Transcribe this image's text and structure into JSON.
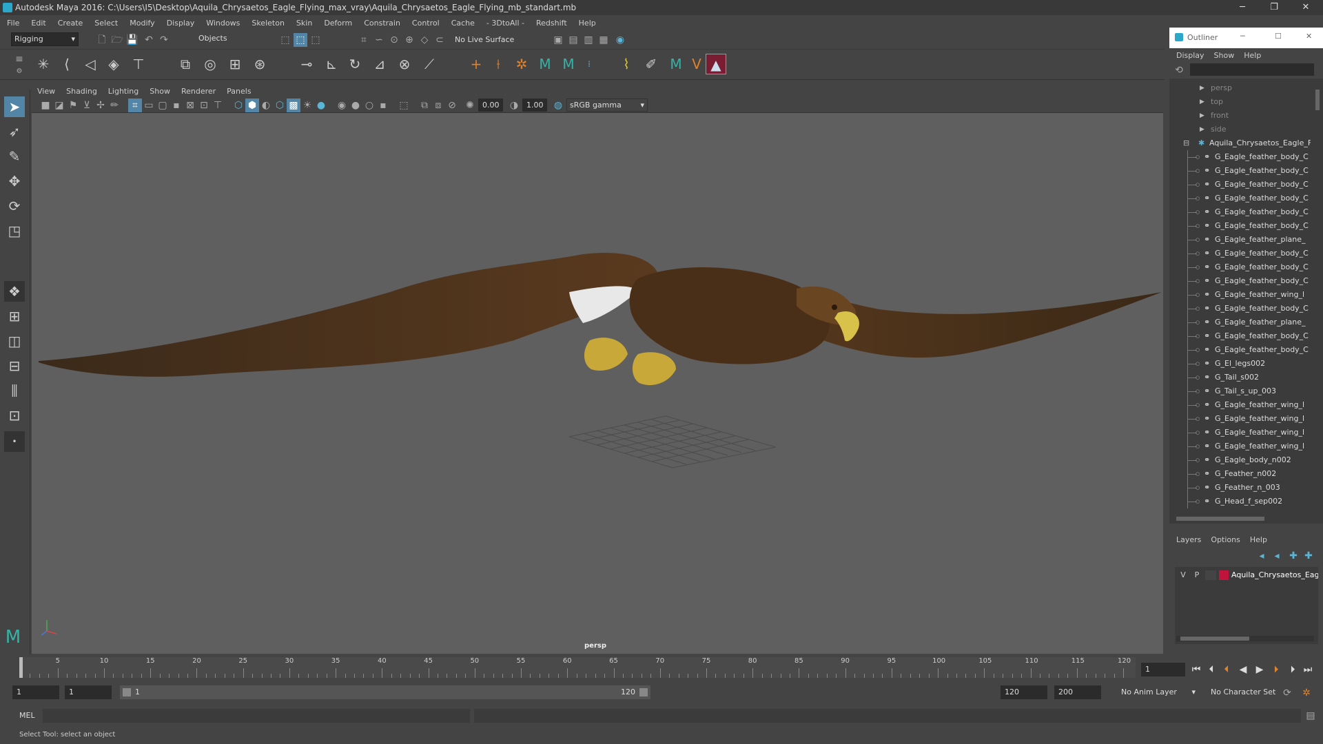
{
  "window": {
    "title": "Autodesk Maya 2016: C:\\Users\\I5\\Desktop\\Aquila_Chrysaetos_Eagle_Flying_max_vray\\Aquila_Chrysaetos_Eagle_Flying_mb_standart.mb",
    "minimize": "─",
    "maximize": "❐",
    "close": "✕"
  },
  "menubar": [
    "File",
    "Edit",
    "Create",
    "Select",
    "Modify",
    "Display",
    "Windows",
    "Skeleton",
    "Skin",
    "Deform",
    "Constrain",
    "Control",
    "Cache",
    "- 3DtoAll -",
    "Redshift",
    "Help"
  ],
  "statusline": {
    "mode": "Rigging",
    "selection_mask": "Objects",
    "live_surface": "No Live Surface"
  },
  "viewport": {
    "menu": [
      "View",
      "Shading",
      "Lighting",
      "Show",
      "Renderer",
      "Panels"
    ],
    "exposure": "0.00",
    "gamma": "1.00",
    "color_space": "sRGB gamma",
    "camera_label": "persp"
  },
  "outliner": {
    "title": "Outliner",
    "menu": [
      "Display",
      "Show",
      "Help"
    ],
    "cameras": [
      "persp",
      "top",
      "front",
      "side"
    ],
    "root": "Aquila_Chrysaetos_Eagle_Fly",
    "items": [
      "G_Eagle_feather_body_C",
      "G_Eagle_feather_body_C",
      "G_Eagle_feather_body_C",
      "G_Eagle_feather_body_C",
      "G_Eagle_feather_body_C",
      "G_Eagle_feather_body_C",
      "G_Eagle_feather_plane_",
      "G_Eagle_feather_body_C",
      "G_Eagle_feather_body_C",
      "G_Eagle_feather_body_C",
      "G_Eagle_feather_wing_l",
      "G_Eagle_feather_body_C",
      "G_Eagle_feather_plane_",
      "G_Eagle_feather_body_C",
      "G_Eagle_feather_body_C",
      "G_El_legs002",
      "G_Tail_s002",
      "G_Tail_s_up_003",
      "G_Eagle_feather_wing_l",
      "G_Eagle_feather_wing_l",
      "G_Eagle_feather_wing_l",
      "G_Eagle_feather_wing_l",
      "G_Eagle_body_n002",
      "G_Feather_n002",
      "G_Feather_n_003",
      "G_Head_f_sep002"
    ]
  },
  "layers": {
    "menu": [
      "Layers",
      "Options",
      "Help"
    ],
    "row": {
      "v": "V",
      "p": "P",
      "name": "Aquila_Chrysaetos_Eag",
      "color": "#c0143c"
    }
  },
  "timeline": {
    "ticks": [
      "1",
      "5",
      "10",
      "15",
      "20",
      "25",
      "30",
      "35",
      "40",
      "45",
      "50",
      "55",
      "60",
      "65",
      "70",
      "75",
      "80",
      "85",
      "90",
      "95",
      "100",
      "105",
      "110",
      "115",
      "120"
    ],
    "current_frame": "1"
  },
  "range": {
    "start": "1",
    "playback_start": "1",
    "slider_start": "1",
    "slider_end": "120",
    "playback_end": "120",
    "end": "200",
    "anim_layer": "No Anim Layer",
    "character_set": "No Character Set"
  },
  "cmdline": {
    "label": "MEL"
  },
  "helpline": {
    "text": "Select Tool: select an object"
  },
  "colors": {
    "accent": "#5285a6",
    "viewport_bg": "#5f5f5f",
    "layer_color": "#c0143c"
  }
}
